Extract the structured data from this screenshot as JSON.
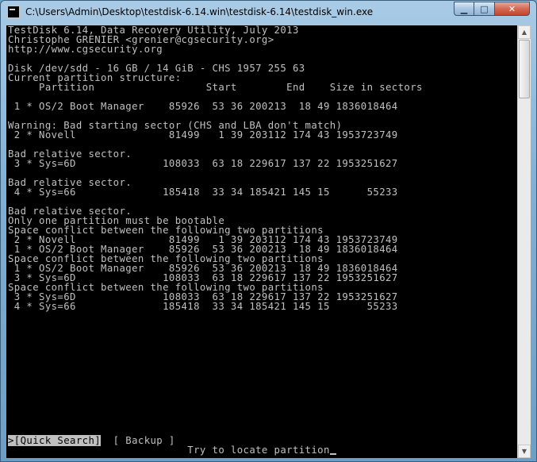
{
  "window": {
    "title": "C:\\Users\\Admin\\Desktop\\testdisk-6.14.win\\testdisk-6.14\\testdisk_win.exe",
    "minimize": "▁",
    "maximize": "□",
    "close": "✕"
  },
  "console": {
    "lines": [
      "TestDisk 6.14, Data Recovery Utility, July 2013",
      "Christophe GRENIER <grenier@cgsecurity.org>",
      "http://www.cgsecurity.org",
      "",
      "Disk /dev/sdd - 16 GB / 14 GiB - CHS 1957 255 63",
      "Current partition structure:",
      "     Partition                  Start        End    Size in sectors",
      "",
      " 1 * OS/2 Boot Manager    85926  53 36 200213  18 49 1836018464",
      "",
      "Warning: Bad starting sector (CHS and LBA don't match)",
      " 2 * Novell               81499   1 39 203112 174 43 1953723749",
      "",
      "Bad relative sector.",
      " 3 * Sys=6D              108033  63 18 229617 137 22 1953251627",
      "",
      "Bad relative sector.",
      " 4 * Sys=66              185418  33 34 185421 145 15      55233",
      "",
      "Bad relative sector.",
      "Only one partition must be bootable",
      "Space conflict between the following two partitions",
      " 2 * Novell               81499   1 39 203112 174 43 1953723749",
      " 1 * OS/2 Boot Manager    85926  53 36 200213  18 49 1836018464",
      "Space conflict between the following two partitions",
      " 1 * OS/2 Boot Manager    85926  53 36 200213  18 49 1836018464",
      " 3 * Sys=6D              108033  63 18 229617 137 22 1953251627",
      "Space conflict between the following two partitions",
      " 3 * Sys=6D              108033  63 18 229617 137 22 1953251627",
      " 4 * Sys=66              185418  33 34 185421 145 15      55233"
    ],
    "menu_selected": ">[Quick Search]",
    "menu_gap": "  ",
    "menu_other": "[ Backup ]",
    "hint": "                             Try to locate partition"
  },
  "colors": {
    "console_bg": "#000000",
    "console_fg": "#c0c0c0"
  }
}
